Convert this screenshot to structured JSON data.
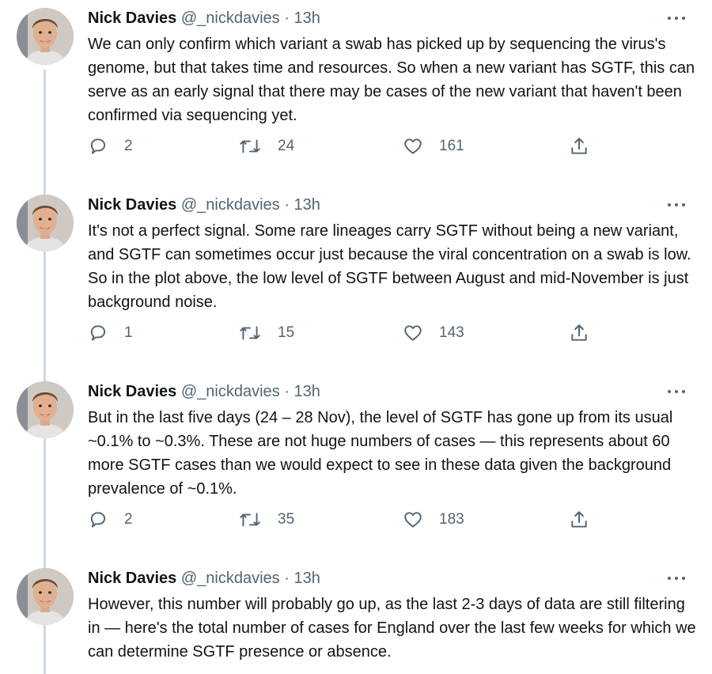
{
  "tweets": [
    {
      "author_name": "Nick Davies",
      "handle": "@_nickdavies",
      "separator": "·",
      "time": "13h",
      "text": "We can only confirm which variant a swab has picked up by sequencing the virus's genome, but that takes time and resources. So when a new variant has SGTF, this can serve as an early signal that there may be cases of the new variant that haven't been confirmed via sequencing yet.",
      "replies": "2",
      "retweets": "24",
      "likes": "161"
    },
    {
      "author_name": "Nick Davies",
      "handle": "@_nickdavies",
      "separator": "·",
      "time": "13h",
      "text": "It's not a perfect signal. Some rare lineages carry SGTF without being a new variant, and SGTF can sometimes occur just because the viral concentration on a swab is low. So in the plot above, the low level of SGTF between August and mid-November is just background noise.",
      "replies": "1",
      "retweets": "15",
      "likes": "143"
    },
    {
      "author_name": "Nick Davies",
      "handle": "@_nickdavies",
      "separator": "·",
      "time": "13h",
      "text": "But in the last five days (24 – 28 Nov), the level of SGTF has gone up from its usual ~0.1% to ~0.3%. These are not huge numbers of cases — this represents about 60 more SGTF cases than we would expect to see in these data given the background prevalence of ~0.1%.",
      "replies": "2",
      "retweets": "35",
      "likes": "183"
    },
    {
      "author_name": "Nick Davies",
      "handle": "@_nickdavies",
      "separator": "·",
      "time": "13h",
      "text": "However, this number will probably go up, as the last 2-3 days of data are still filtering in — here's the total number of cases for England over the last few weeks for which we can determine SGTF presence or absence."
    }
  ],
  "icons": {
    "reply": "reply-icon",
    "retweet": "retweet-icon",
    "like": "heart-icon",
    "share": "share-icon",
    "more": "more-icon"
  },
  "colors": {
    "text_primary": "#0f1419",
    "text_secondary": "#536471",
    "thread_line": "#cfd9de"
  }
}
